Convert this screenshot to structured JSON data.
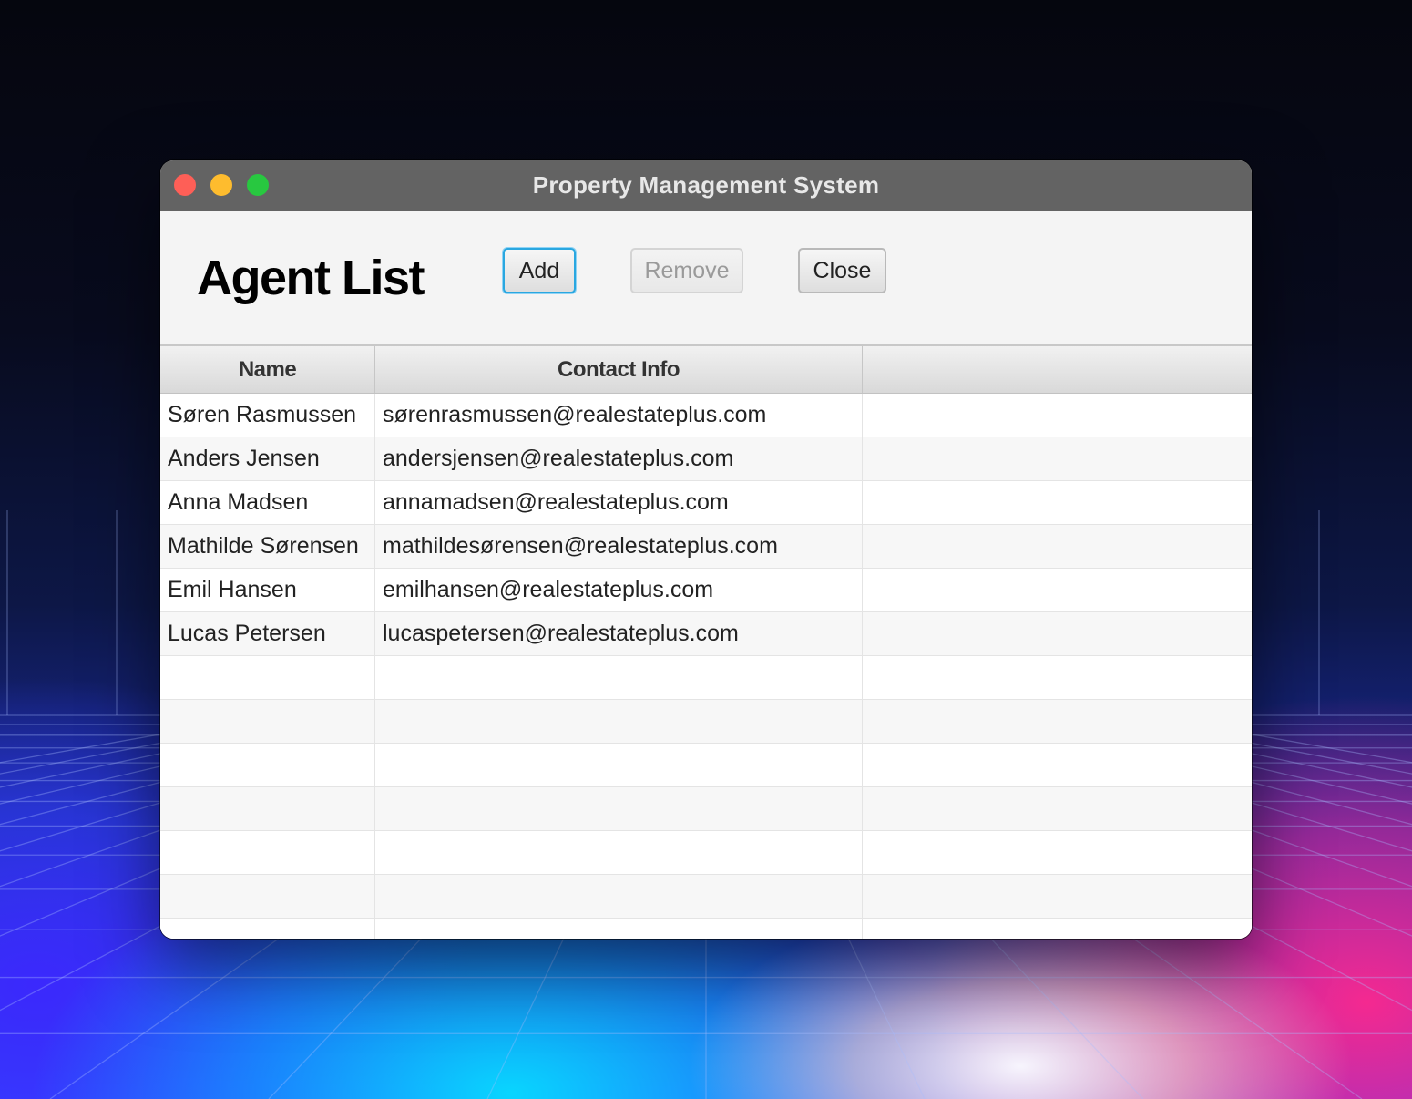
{
  "window": {
    "title": "Property Management System"
  },
  "main": {
    "heading": "Agent List",
    "buttons": {
      "add_label": "Add",
      "remove_label": "Remove",
      "close_label": "Close"
    }
  },
  "table": {
    "columns": [
      "Name",
      "Contact Info",
      ""
    ],
    "rows": [
      {
        "name": "Søren Rasmussen",
        "contact": "sørenrasmussen@realestateplus.com"
      },
      {
        "name": "Anders Jensen",
        "contact": "andersjensen@realestateplus.com"
      },
      {
        "name": "Anna Madsen",
        "contact": "annamadsen@realestateplus.com"
      },
      {
        "name": "Mathilde Sørensen",
        "contact": "mathildesørensen@realestateplus.com"
      },
      {
        "name": "Emil Hansen",
        "contact": "emilhansen@realestateplus.com"
      },
      {
        "name": "Lucas Petersen",
        "contact": "lucaspetersen@realestateplus.com"
      }
    ]
  },
  "colors": {
    "titlebar": "#636363",
    "close_dot": "#fe5f57",
    "minimize_dot": "#febc2e",
    "maximize_dot": "#28c840",
    "focus_ring": "#2aa7e0"
  }
}
